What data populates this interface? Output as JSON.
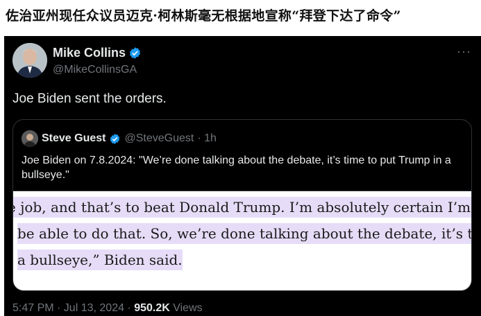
{
  "headline": "佐治亚州现任众议员迈克·柯林斯毫无根据地宣称“拜登下达了命令”",
  "tweet": {
    "author_name": "Mike Collins",
    "author_handle": "@MikeCollinsGA",
    "more_label": "···",
    "text": "Joe Biden sent the orders.",
    "time": "5:47 PM · Jul 13, 2024 · ",
    "views_count": "950.2K",
    "views_label": " Views"
  },
  "quote": {
    "author_name": "Steve Guest",
    "author_handle": "@SteveGuest",
    "time_ago": "· 1h",
    "text": "Joe Biden on 7.8.2024: \"We’re done talking about the debate, it’s time to put Trump in a bullseye.\"",
    "image_lines": [
      "e job, and that’s to beat Donald Trump. I’m absolutely certain I’m",
      "be able to do that. So, we’re done talking about the debate, it’s time",
      "a bullseye,” Biden said."
    ]
  },
  "colors": {
    "verified": "#1d9bf0",
    "highlight": "#e6dcf7",
    "muted_text": "#71767b"
  },
  "icons": {
    "verified": "verified-badge-icon",
    "more": "more-options-icon"
  }
}
